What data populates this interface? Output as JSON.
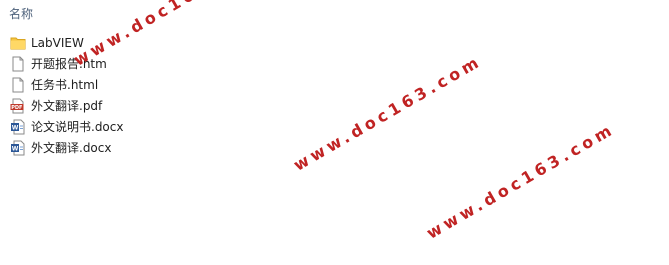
{
  "header": {
    "name_label": "名称"
  },
  "files": [
    {
      "name": "LabVIEW",
      "icon": "folder-icon"
    },
    {
      "name": "开题报告.htm",
      "icon": "html-file-icon"
    },
    {
      "name": "任务书.html",
      "icon": "html-file-icon"
    },
    {
      "name": "外文翻译.pdf",
      "icon": "pdf-file-icon"
    },
    {
      "name": "论文说明书.docx",
      "icon": "word-file-icon"
    },
    {
      "name": "外文翻译.docx",
      "icon": "word-file-icon"
    }
  ],
  "watermarks": [
    "www.doc163.com",
    "www.doc163.com",
    "www.doc163.com"
  ],
  "colors": {
    "folder": "#f5c542",
    "pdf": "#c0392b",
    "word": "#2b5797",
    "watermark": "#c02323"
  }
}
